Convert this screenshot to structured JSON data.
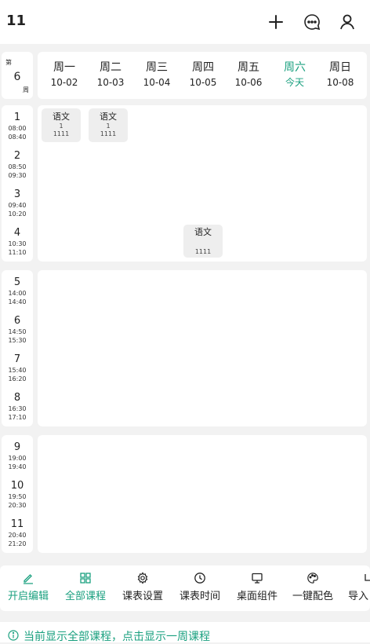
{
  "app": {
    "title": "11"
  },
  "header": {
    "icons": [
      "plus-icon",
      "chat-icon",
      "user-icon"
    ]
  },
  "week": {
    "prefix": "第",
    "number": "6",
    "suffix": "周"
  },
  "days": [
    {
      "name": "周一",
      "date": "10-02",
      "today": false
    },
    {
      "name": "周二",
      "date": "10-03",
      "today": false
    },
    {
      "name": "周三",
      "date": "10-04",
      "today": false
    },
    {
      "name": "周四",
      "date": "10-05",
      "today": false
    },
    {
      "name": "周五",
      "date": "10-06",
      "today": false
    },
    {
      "name": "周六",
      "date": "今天",
      "today": true
    },
    {
      "name": "周日",
      "date": "10-08",
      "today": false
    }
  ],
  "periods": [
    {
      "num": "1",
      "start": "08:00",
      "end": "08:40"
    },
    {
      "num": "2",
      "start": "08:50",
      "end": "09:30"
    },
    {
      "num": "3",
      "start": "09:40",
      "end": "10:20"
    },
    {
      "num": "4",
      "start": "10:30",
      "end": "11:10"
    },
    {
      "num": "5",
      "start": "14:00",
      "end": "14:40"
    },
    {
      "num": "6",
      "start": "14:50",
      "end": "15:30"
    },
    {
      "num": "7",
      "start": "15:40",
      "end": "16:20"
    },
    {
      "num": "8",
      "start": "16:30",
      "end": "17:10"
    },
    {
      "num": "9",
      "start": "19:00",
      "end": "19:40"
    },
    {
      "num": "10",
      "start": "19:50",
      "end": "20:30"
    },
    {
      "num": "11",
      "start": "20:40",
      "end": "21:20"
    }
  ],
  "courses": [
    {
      "name": "语文",
      "count": "1",
      "room": "1111",
      "day": "周一",
      "period": "1"
    },
    {
      "name": "语文",
      "count": "1",
      "room": "1111",
      "day": "周二",
      "period": "1"
    },
    {
      "name": "语文",
      "count": "",
      "room": "1111",
      "day": "周四",
      "period": "4"
    }
  ],
  "toolbar": {
    "items": [
      {
        "label": "开启编辑",
        "icon": "pencil-icon",
        "active": true
      },
      {
        "label": "全部课程",
        "icon": "grid-icon",
        "active": true
      },
      {
        "label": "课表设置",
        "icon": "gear-icon",
        "active": false
      },
      {
        "label": "课表时间",
        "icon": "clock-icon",
        "active": false
      },
      {
        "label": "桌面组件",
        "icon": "monitor-icon",
        "active": false
      },
      {
        "label": "一键配色",
        "icon": "palette-icon",
        "active": false
      },
      {
        "label": "导入",
        "icon": "import-icon",
        "active": false
      }
    ]
  },
  "notice": {
    "text": "当前显示全部课程，点击显示一周课程",
    "icon": "info-icon"
  },
  "colors": {
    "accent": "#1aa07f",
    "background": "#f2f2f2",
    "card": "#ffffff",
    "course_bg": "#eeeeee"
  }
}
